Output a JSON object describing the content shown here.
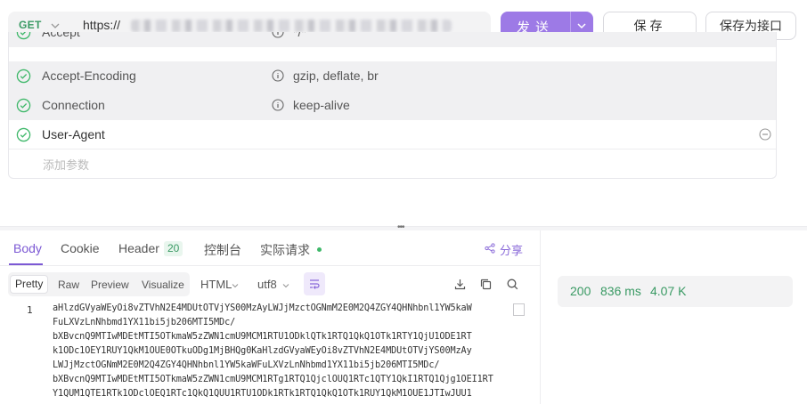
{
  "request": {
    "method": "GET",
    "url_visible": "https://",
    "send_label": "发送",
    "save_label": "保存",
    "save_as_label": "保存为接口"
  },
  "headers": [
    {
      "key": "Accept",
      "value": "*/*",
      "enabled": true
    },
    {
      "key": "Accept-Encoding",
      "value": "gzip, deflate, br",
      "enabled": true
    },
    {
      "key": "Connection",
      "value": "keep-alive",
      "enabled": true
    },
    {
      "key": "User-Agent",
      "value": "",
      "enabled": true
    }
  ],
  "add_param_placeholder": "添加参数",
  "response": {
    "tabs": {
      "body": "Body",
      "cookie": "Cookie",
      "header": "Header",
      "header_count": "20",
      "console": "控制台",
      "actual_request": "实际请求"
    },
    "share_label": "分享",
    "formats": [
      "Pretty",
      "Raw",
      "Preview",
      "Visualize"
    ],
    "selected_format": "Pretty",
    "language": "HTML",
    "encoding": "utf8",
    "line_number": "1",
    "body_lines": [
      "aHlzdGVyaWEyOi8vZTVhN2E4MDUtOTVjYS00MzAyLWJjMzctOGNmM2E0M2Q4ZGY4QHNhbnl1YW5kaW",
      "FuLXVzLnNhbmd1YX11bi5jb206MTI5MDc/",
      "bXBvcnQ9MTIwMDEtMTI5OTkmaW5zZWN1cmU9MCM1RTU1ODklQTk1RTQ1QkQ1OTk1RTY1QjU1ODE1RT",
      "k1ODc1OEY1RUY1QkM1OUE0OTkuODg1MjBHQg0KaHlzdGVyaWEyOi8vZTVhN2E4MDUtOTVjYS00MzAy",
      "LWJjMzctOGNmM2E0M2Q4ZGY4QHNhbnl1YW5kaWFuLXVzLnNhbmd1YX11bi5jb206MTI5MDc/",
      "bXBvcnQ9MTIwMDEtMTI5OTkmaW5zZWN1cmU9MCM1RTg1RTQ1QjclOUQ1RTc1QTY1QkI1RTQ1Qjg1OEI1RT",
      "Y1QUM1QTE1RTk1ODclOEQ1RTc1QkQ1QUU1RTU1ODk1RTk1RTQ1QkQ1OTk1RUY1QkM1OUE1JTIwJUU1"
    ],
    "status": "200",
    "time": "836 ms",
    "size": "4.07 K"
  },
  "colors": {
    "accent": "#9d7ae6",
    "success": "#3a9a64",
    "tab_active": "#7c59d4"
  }
}
